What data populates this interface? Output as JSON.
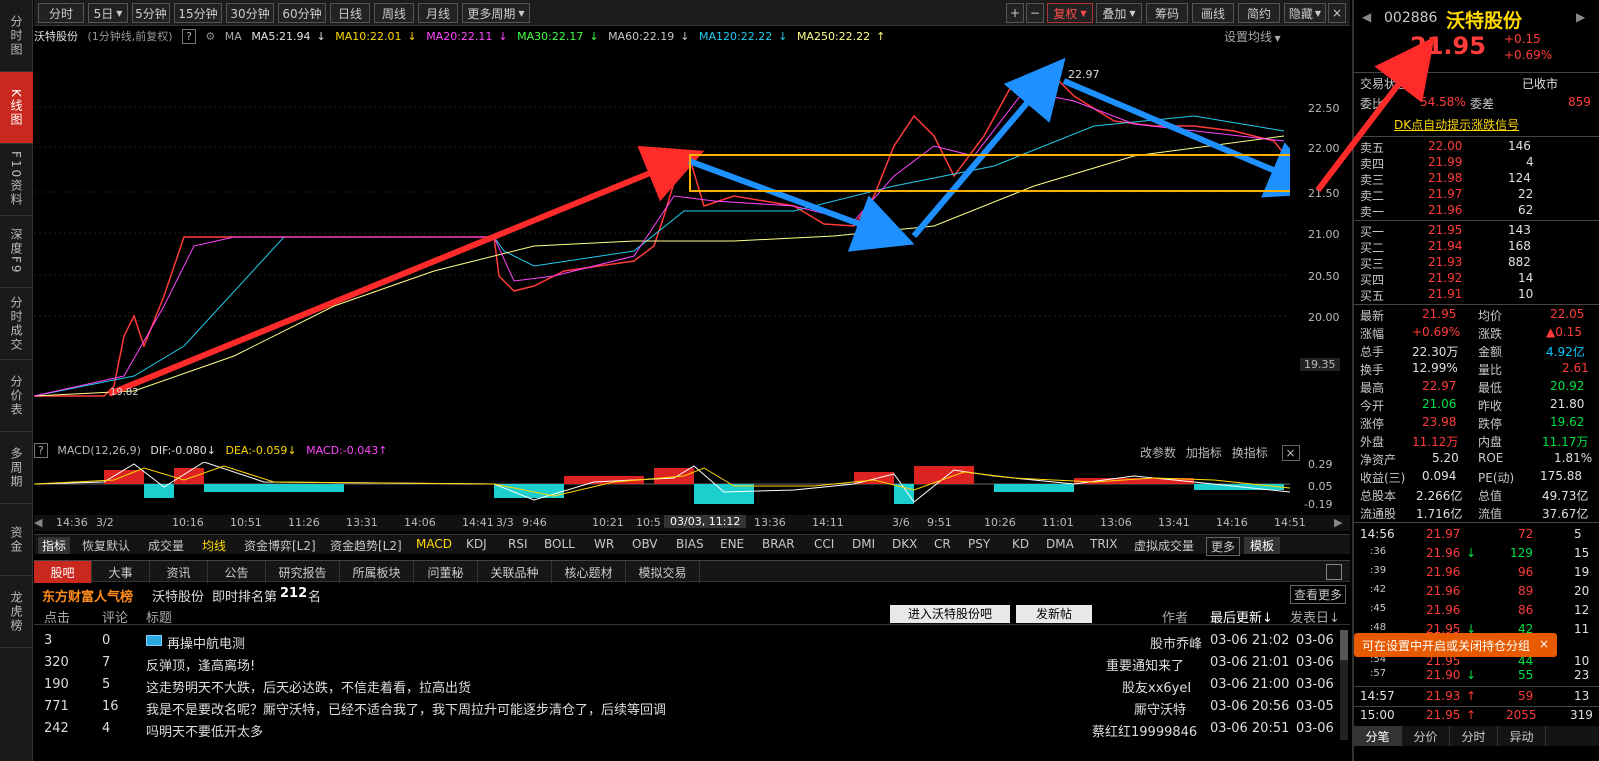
{
  "left_tabs": [
    "分时图",
    "K线图",
    "F10资料",
    "深度F9",
    "分时成交",
    "分价表",
    "多周期",
    "资金",
    "龙虎榜"
  ],
  "topbar": {
    "periods": [
      "分时",
      "5日",
      "5分钟",
      "15分钟",
      "30分钟",
      "60分钟",
      "日线",
      "周线",
      "月线",
      "更多周期"
    ],
    "right": [
      "+",
      "−",
      "复权",
      "叠加",
      "筹码",
      "画线",
      "简约",
      "隐藏"
    ],
    "close": "×"
  },
  "ma": {
    "title": "沃特股份",
    "subtitle": "(1分钟线,前复权)",
    "help": "?",
    "ma_label": "MA",
    "ma5": "MA5:21.94",
    "ma10": "MA10:22.01",
    "ma20": "MA20:22.11",
    "ma30": "MA30:22.17",
    "ma60": "MA60:22.19",
    "ma120": "MA120:22.22",
    "ma250": "MA250:22.22",
    "settings": "设置均线"
  },
  "yaxis": [
    "22.50",
    "22.00",
    "21.50",
    "21.00",
    "20.50",
    "20.00",
    "19.35"
  ],
  "chart_labels": {
    "high": "22.97",
    "low_mark": "19.82"
  },
  "macd": {
    "help": "?",
    "label": "MACD(12,26,9)",
    "dif": "DIF:-0.080",
    "dea": "DEA:-0.059",
    "macd": "MACD:-0.043",
    "links": [
      "改参数",
      "加指标",
      "换指标"
    ],
    "close": "×",
    "y": [
      "0.29",
      "0.05",
      "-0.19"
    ]
  },
  "time_axis": [
    "14:36",
    "3/2",
    "10:16",
    "10:51",
    "11:26",
    "13:31",
    "14:06",
    "14:41",
    "3/3",
    "9:46",
    "10:21",
    "10:5",
    "03/03, 11:12",
    "13:36",
    "14:11",
    "3/6",
    "9:51",
    "10:26",
    "11:01",
    "13:06",
    "13:41",
    "14:16",
    "14:51"
  ],
  "indicators": [
    "指标",
    "恢复默认",
    "成交量",
    "均线",
    "资金博弈[L2]",
    "资金趋势[L2]",
    "MACD",
    "KDJ",
    "RSI",
    "BOLL",
    "WR",
    "OBV",
    "BIAS",
    "ENE",
    "BRAR",
    "CCI",
    "DMI",
    "DKX",
    "CR",
    "PSY",
    "KD",
    "DMA",
    "TRIX",
    "虚拟成交量",
    "更多",
    "模板"
  ],
  "tabs": [
    "股吧",
    "大事",
    "资讯",
    "公告",
    "研究报告",
    "所属板块",
    "问董秘",
    "关联品种",
    "核心题材",
    "模拟交易"
  ],
  "forum": {
    "title": "东方财富人气榜",
    "stock": "沃特股份",
    "rank_label": "即时排名第",
    "rank": "212",
    "rank_unit": "名",
    "more": "查看更多",
    "enter_btn": "进入沃特股份吧",
    "post_btn": "发新帖"
  },
  "columns": {
    "clicks": "点击",
    "comments": "评论",
    "title": "标题",
    "author": "作者",
    "updated": "最后更新",
    "posted": "发表日"
  },
  "posts": [
    {
      "clicks": "3",
      "comments": "0",
      "title": "再操中航电测",
      "author": "股市乔峰",
      "updated": "03-06 21:02",
      "posted": "03-06"
    },
    {
      "clicks": "320",
      "comments": "7",
      "title": "反弹顶，逢高离场!",
      "author": "重要通知来了",
      "updated": "03-06 21:01",
      "posted": "03-06"
    },
    {
      "clicks": "190",
      "comments": "5",
      "title": "这走势明天不大跌，后天必达跌，不信走着看，拉高出货",
      "author": "股友xx6yeI",
      "updated": "03-06 21:00",
      "posted": "03-06"
    },
    {
      "clicks": "771",
      "comments": "16",
      "title": "我是不是要改名呢？厮守沃特，已经不适合我了，我下周拉升可能逐步清仓了，后续等回调",
      "author": "厮守沃特",
      "updated": "03-06 20:56",
      "posted": "03-05"
    },
    {
      "clicks": "242",
      "comments": "4",
      "title": "吗明天不要低开太多",
      "author": "蔡红红19999846",
      "updated": "03-06 20:51",
      "posted": "03-06"
    }
  ],
  "stock": {
    "code": "002886",
    "name": "沃特股份",
    "price": "21.95",
    "change": "+0.15",
    "pct": "+0.69%",
    "status_label": "交易状态",
    "status": "已收市",
    "weibi_label": "委比",
    "weibi": "54.58%",
    "weicha_label": "委差",
    "weicha": "859",
    "dk": "DK点自动提示涨跌信号"
  },
  "asks": [
    [
      "卖五",
      "22.00",
      "146"
    ],
    [
      "卖四",
      "21.99",
      "4"
    ],
    [
      "卖三",
      "21.98",
      "124"
    ],
    [
      "卖二",
      "21.97",
      "22"
    ],
    [
      "卖一",
      "21.96",
      "62"
    ]
  ],
  "bids": [
    [
      "买一",
      "21.95",
      "143"
    ],
    [
      "买二",
      "21.94",
      "168"
    ],
    [
      "买三",
      "21.93",
      "882"
    ],
    [
      "买四",
      "21.92",
      "14"
    ],
    [
      "买五",
      "21.91",
      "10"
    ]
  ],
  "stats": [
    [
      "最新",
      "21.95",
      "均价",
      "22.05"
    ],
    [
      "涨幅",
      "+0.69%",
      "涨跌",
      "▲0.15"
    ],
    [
      "总手",
      "22.30万",
      "金额",
      "4.92亿"
    ],
    [
      "换手",
      "12.99%",
      "量比",
      "2.61"
    ],
    [
      "最高",
      "22.97",
      "最低",
      "20.92"
    ],
    [
      "今开",
      "21.06",
      "昨收",
      "21.80"
    ],
    [
      "涨停",
      "23.98",
      "跌停",
      "19.62"
    ],
    [
      "外盘",
      "11.12万",
      "内盘",
      "11.17万"
    ],
    [
      "净资产",
      "5.20",
      "ROE",
      "1.81%"
    ],
    [
      "收益(三)",
      "0.094",
      "PE(动)",
      "175.88"
    ],
    [
      "总股本",
      "2.266亿",
      "总值",
      "49.73亿"
    ],
    [
      "流通股",
      "1.716亿",
      "流值",
      "37.67亿"
    ]
  ],
  "ticks": [
    [
      "14:56",
      "21.97",
      "",
      "72",
      "5"
    ],
    [
      ":36",
      "21.96",
      "↓",
      "129",
      "15"
    ],
    [
      ":39",
      "21.96",
      "",
      "96",
      "19"
    ],
    [
      ":42",
      "21.96",
      "",
      "89",
      "20"
    ],
    [
      ":45",
      "21.96",
      "",
      "86",
      "12"
    ],
    [
      ":48",
      "21.95",
      "↓",
      "42",
      "11"
    ],
    [
      ":54",
      "21.95",
      "",
      "44",
      "10"
    ],
    [
      ":57",
      "21.90",
      "↓",
      "55",
      "23"
    ],
    [
      "14:57",
      "21.93",
      "↑",
      "59",
      "13"
    ],
    [
      "15:00",
      "21.95",
      "↑",
      "2055",
      "319"
    ]
  ],
  "tooltip": "可在设置中开启或关闭持仓分组",
  "tooltip_close": "×",
  "bottom_tabs": [
    "分笔",
    "分价",
    "分时",
    "异动"
  ]
}
